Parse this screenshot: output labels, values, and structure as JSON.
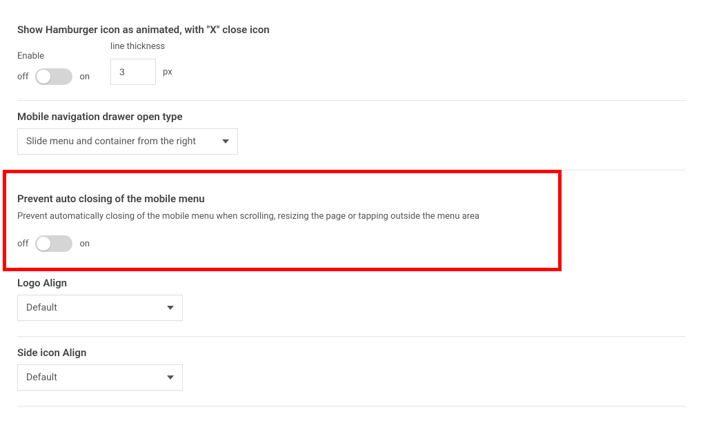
{
  "hamburger": {
    "title": "Show Hamburger icon as animated, with \"X\" close icon",
    "enable_label": "Enable",
    "off": "off",
    "on": "on",
    "thickness_label": "line thickness",
    "thickness_value": "3",
    "unit": "px"
  },
  "nav_drawer": {
    "title": "Mobile navigation drawer open type",
    "selected": "Slide menu and container from the right"
  },
  "prevent_close": {
    "title": "Prevent auto closing of the mobile menu",
    "desc": "Prevent automatically closing of the mobile menu when scrolling, resizing the page or tapping outside the menu area",
    "off": "off",
    "on": "on"
  },
  "logo_align": {
    "title": "Logo Align",
    "selected": "Default"
  },
  "side_icon": {
    "title": "Side icon Align",
    "selected": "Default"
  }
}
